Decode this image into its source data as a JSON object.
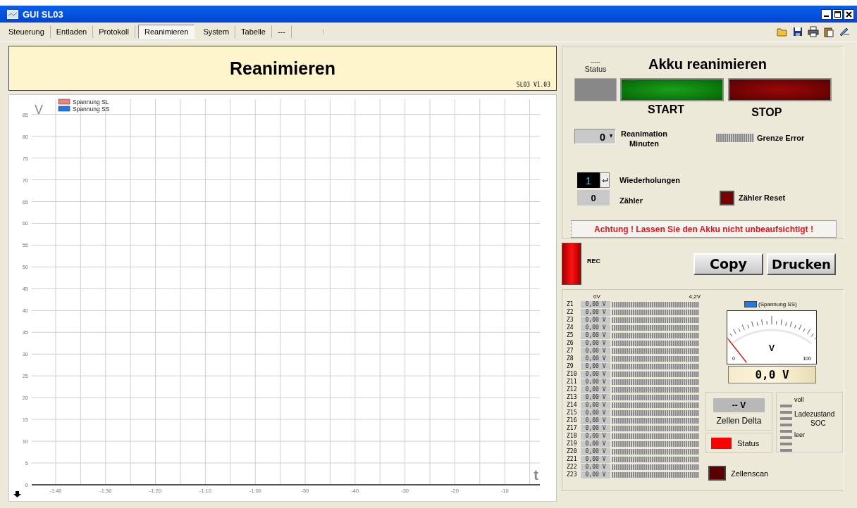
{
  "window": {
    "title": "GUI SL03"
  },
  "tabs": [
    {
      "label": "Steuerung",
      "selected": false
    },
    {
      "label": "Entladen",
      "selected": false
    },
    {
      "label": "Protokoll",
      "selected": false
    },
    {
      "label": "Reanimieren",
      "selected": true
    },
    {
      "label": "System",
      "selected": false
    },
    {
      "label": "Tabelle",
      "selected": false
    },
    {
      "label": "---",
      "selected": false
    }
  ],
  "header": {
    "title": "Reanimieren",
    "version": "SL03 V1.03"
  },
  "chart": {
    "chart_data": {
      "type": "line",
      "xlabel": "t",
      "ylabel": "V",
      "grid": true,
      "ylim": [
        0,
        88.5
      ],
      "categories": [
        "-1:40",
        "-1:30",
        "-1:20",
        "-1:10",
        "-1:00",
        "-50",
        "-40",
        "-30",
        "-20",
        "-10"
      ],
      "yticks": [
        0,
        5,
        10,
        15,
        20,
        25,
        30,
        35,
        40,
        45,
        50,
        55,
        60,
        65,
        70,
        75,
        80,
        85
      ],
      "series": [
        {
          "name": "Spannung SL",
          "color": "#f08080",
          "values": [
            null,
            null,
            null,
            null,
            null,
            null,
            null,
            null,
            null,
            null
          ]
        },
        {
          "name": "Spannung SS",
          "color": "#1e78f0",
          "values": [
            null,
            null,
            null,
            null,
            null,
            null,
            null,
            null,
            null,
            null
          ]
        }
      ]
    }
  },
  "control": {
    "title": "Akku reanimieren",
    "status_dashes": "-----",
    "status_label": "Status",
    "start_label": "START",
    "stop_label": "STOP",
    "minutes": {
      "value": "0",
      "label": "Reanimation Minuten"
    },
    "limit_label": "Grenze Error",
    "repetitions": {
      "value": "1",
      "label": "Wiederholungen"
    },
    "counter": {
      "value": "0",
      "label": "Zähler"
    },
    "counter_reset": "Zähler Reset",
    "warning": "Achtung !  Lassen Sie den Akku nicht unbeaufsichtigt !"
  },
  "rec": {
    "label": "REC"
  },
  "buttons": [
    "Copy",
    "Drucken"
  ],
  "cells": {
    "scale_min": "0V",
    "scale_max": "4,2V",
    "rows": [
      {
        "label": "Z1",
        "value": "0,00 V"
      },
      {
        "label": "Z2",
        "value": "0,00 V"
      },
      {
        "label": "Z3",
        "value": "0,00 V"
      },
      {
        "label": "Z4",
        "value": "0,00 V"
      },
      {
        "label": "Z5",
        "value": "0,00 V"
      },
      {
        "label": "Z6",
        "value": "0,00 V"
      },
      {
        "label": "Z7",
        "value": "0,00 V"
      },
      {
        "label": "Z8",
        "value": "0,00 V"
      },
      {
        "label": "Z9",
        "value": "0,00 V"
      },
      {
        "label": "Z10",
        "value": "0,00 V"
      },
      {
        "label": "Z11",
        "value": "0,00 V"
      },
      {
        "label": "Z12",
        "value": "0,00 V"
      },
      {
        "label": "Z13",
        "value": "0,00 V"
      },
      {
        "label": "Z14",
        "value": "0,00 V"
      },
      {
        "label": "Z15",
        "value": "0,00 V"
      },
      {
        "label": "Z16",
        "value": "0,00 V"
      },
      {
        "label": "Z17",
        "value": "0,00 V"
      },
      {
        "label": "Z18",
        "value": "0,00 V"
      },
      {
        "label": "Z19",
        "value": "0,00 V"
      },
      {
        "label": "Z20",
        "value": "0,00 V"
      },
      {
        "label": "Z21",
        "value": "0,00 V"
      },
      {
        "label": "Z22",
        "value": "0,00 V"
      },
      {
        "label": "Z23",
        "value": "0,00 V"
      }
    ]
  },
  "gauge": {
    "legend": "(Spannung SS)",
    "unit": "V",
    "min": "0",
    "max": "100",
    "level": 0,
    "reading": "0,0 V"
  },
  "delta": {
    "value": "-- V",
    "label": "Zellen Delta"
  },
  "status": {
    "label": "Status"
  },
  "soc": {
    "top": "voll",
    "title": "Ladezustand",
    "subtitle": "SOC",
    "bottom": "leer"
  },
  "scan": {
    "label": "Zellenscan"
  }
}
